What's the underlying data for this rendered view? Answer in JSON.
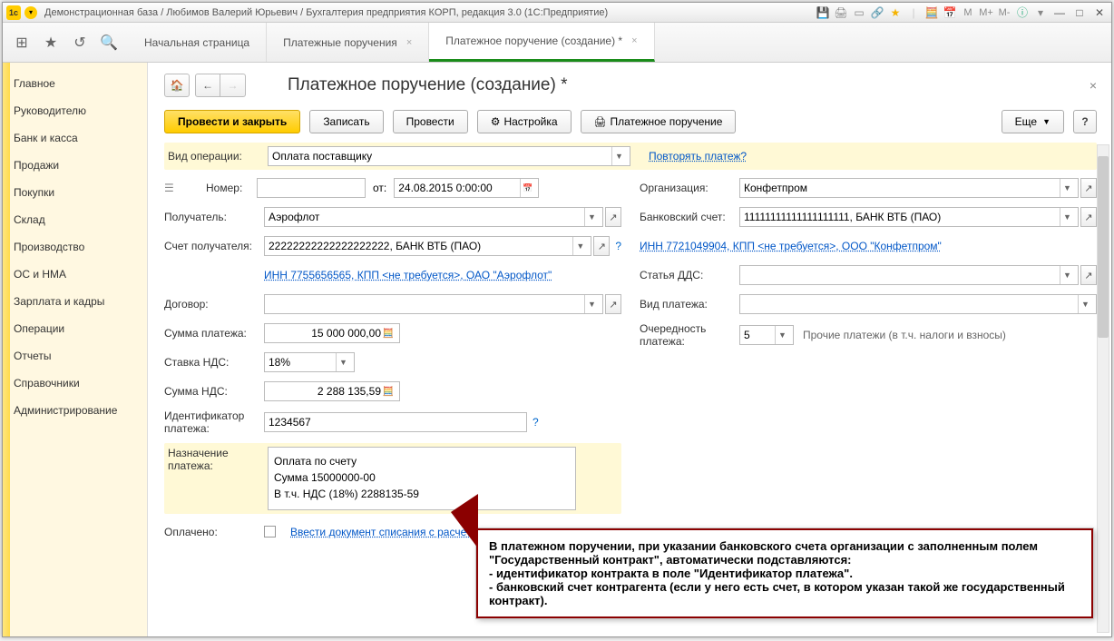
{
  "window_title": "Демонстрационная база / Любимов Валерий Юрьевич / Бухгалтерия предприятия КОРП, редакция 3.0  (1С:Предприятие)",
  "tabs": [
    {
      "label": "Начальная страница",
      "closable": false
    },
    {
      "label": "Платежные поручения",
      "closable": true
    },
    {
      "label": "Платежное поручение (создание) *",
      "closable": true,
      "active": true
    }
  ],
  "sidebar": [
    "Главное",
    "Руководителю",
    "Банк и касса",
    "Продажи",
    "Покупки",
    "Склад",
    "Производство",
    "ОС и НМА",
    "Зарплата и кадры",
    "Операции",
    "Отчеты",
    "Справочники",
    "Администрирование"
  ],
  "page_title": "Платежное поручение (создание) *",
  "buttons": {
    "post_close": "Провести и закрыть",
    "save": "Записать",
    "post": "Провести",
    "settings": "Настройка",
    "print_po": "Платежное поручение",
    "more": "Еще"
  },
  "links": {
    "repeat_payment": "Повторять платеж?",
    "inn_payer": "ИНН 7755656565, КПП <не требуется>, ОАО \"Аэрофлот\"",
    "inn_org": "ИНН 7721049904, КПП <не требуется>, ООО \"Конфетпром\"",
    "writeoff": "Ввести документ списания с расчетного счета"
  },
  "labels": {
    "op_type": "Вид операции:",
    "number": "Номер:",
    "from": "от:",
    "recipient": "Получатель:",
    "recipient_acc": "Счет получателя:",
    "contract": "Договор:",
    "amount": "Сумма платежа:",
    "vat_rate": "Ставка НДС:",
    "vat_sum": "Сумма НДС:",
    "payment_id": "Идентификатор платежа:",
    "purpose": "Назначение платежа:",
    "paid": "Оплачено:",
    "organization": "Организация:",
    "bank_account": "Банковский счет:",
    "dds": "Статья ДДС:",
    "payment_type": "Вид платежа:",
    "priority": "Очередность платежа:",
    "priority_note": "Прочие платежи (в т.ч. налоги и взносы)"
  },
  "values": {
    "op_type": "Оплата поставщику",
    "number": "",
    "date": "24.08.2015  0:00:00",
    "recipient": "Аэрофлот",
    "recipient_acc": "22222222222222222222, БАНК ВТБ (ПАО)",
    "contract": "",
    "amount": "15 000 000,00",
    "vat_rate": "18%",
    "vat_sum": "2 288 135,59",
    "payment_id": "1234567",
    "purpose_l1": "Оплата по счету",
    "purpose_l2": "Сумма 15000000-00",
    "purpose_l3": "В т.ч. НДС  (18%) 2288135-59",
    "organization": "Конфетпром",
    "bank_account": "11111111111111111111, БАНК ВТБ (ПАО)",
    "dds": "",
    "payment_type": "",
    "priority": "5"
  },
  "callout": {
    "l1": "В платежном поручении, при указании банковского счета организации с заполненным полем \"Государственный контракт\", автоматически подставляются:",
    "l2": "- идентификатор контракта в поле \"Идентификатор платежа\".",
    "l3": "- банковский счет контрагента (если у него есть счет, в котором указан такой же государственный контракт)."
  },
  "m_buttons": [
    "M",
    "M+",
    "M-"
  ]
}
